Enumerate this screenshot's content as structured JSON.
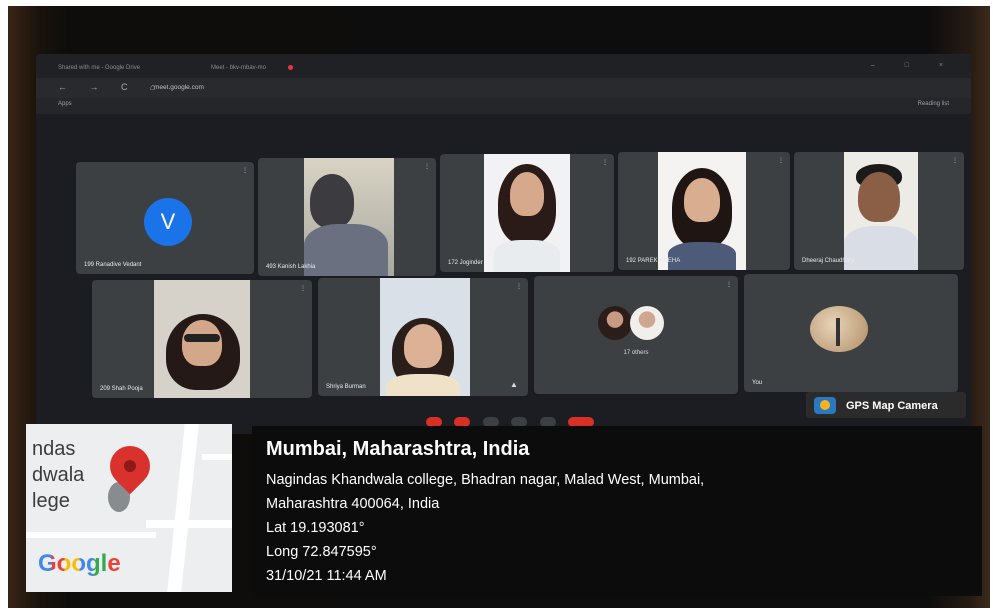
{
  "browser": {
    "tab1_title": "Shared with me - Google Drive",
    "tab2_title": "Meet - bkv-mbav-mo",
    "window_controls": "– □ ×",
    "nav_buttons": "← → C ⌂",
    "url": "meet.google.com",
    "bookmarks_apps": "Apps",
    "reading_list": "Reading list"
  },
  "meet": {
    "participants": [
      {
        "name": "199 Ranadive Vedant",
        "avatar_letter": "V"
      },
      {
        "name": "493 Kanish Lakhia"
      },
      {
        "name": "172 Joginder"
      },
      {
        "name": "192 PAREKH NEHA"
      },
      {
        "name": "Dheeraj Chaudhary"
      },
      {
        "name": "209 Shah Pooja"
      },
      {
        "name": "Shriya Burman"
      },
      {
        "name": "17 others"
      },
      {
        "name": "You"
      }
    ]
  },
  "overlay": {
    "badge_label": "GPS Map Camera",
    "city": "Mumbai, Maharashtra, India",
    "address_line1": "Nagindas Khandwala college, Bhadran nagar, Malad West, Mumbai,",
    "address_line2": "Maharashtra 400064, India",
    "latitude": "Lat 19.193081°",
    "longitude": "Long 72.847595°",
    "datetime": "31/10/21 11:44 AM",
    "map_labels": [
      "ndas",
      "dwala",
      "lege"
    ],
    "map_brand": "Google"
  },
  "colors": {
    "meet_tile": "#3c4043",
    "avatar_blue": "#1a73e8",
    "pin_red": "#d9312c",
    "end_call_red": "#d93025"
  }
}
